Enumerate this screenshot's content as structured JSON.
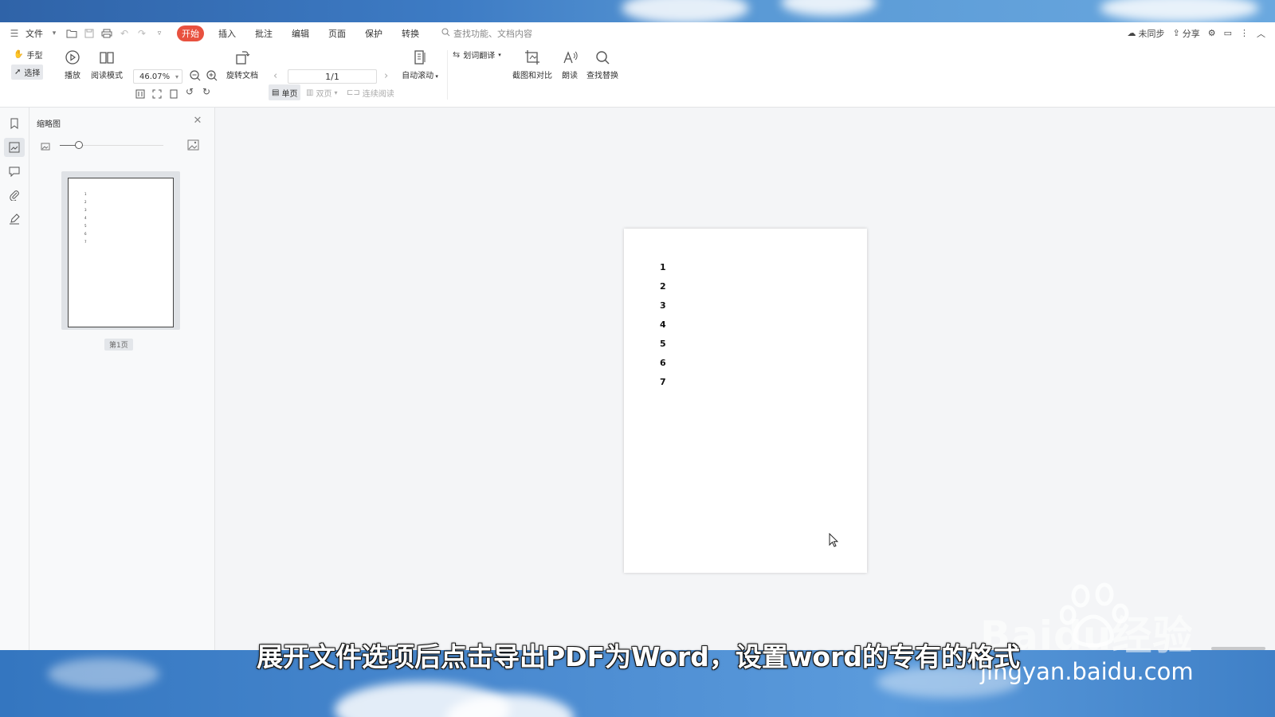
{
  "menu": {
    "file_label": "文件",
    "tabs": [
      "开始",
      "插入",
      "批注",
      "编辑",
      "页面",
      "保护",
      "转换"
    ],
    "active_tab": "开始",
    "search_placeholder": "查找功能、文档内容",
    "sync_label": "未同步",
    "share_label": "分享"
  },
  "toolbar": {
    "hand_label": "手型",
    "select_label": "选择",
    "play_label": "播放",
    "read_mode_label": "阅读模式",
    "zoom_value": "46.07%",
    "rotate_doc_label": "旋转文档",
    "page_indicator": "1/1",
    "single_page_label": "单页",
    "double_page_label": "双页",
    "continuous_label": "连续阅读",
    "auto_scroll_label": "自动滚动",
    "translate_label": "划词翻译",
    "screenshot_compare_label": "截图和对比",
    "read_aloud_label": "朗读",
    "find_replace_label": "查找替换"
  },
  "thumbnail_panel": {
    "title": "缩略图",
    "page_label": "第1页",
    "thumb_lines": [
      "1",
      "2",
      "3",
      "4",
      "5",
      "6",
      "7"
    ]
  },
  "document": {
    "lines": [
      "1",
      "2",
      "3",
      "4",
      "5",
      "6",
      "7"
    ]
  },
  "overlay": {
    "subtitle": "展开文件选项后点击导出PDF为Word，设置word的专有的格式",
    "watermark_brand": "Baidu经验",
    "watermark_url": "jingyan.baidu.com"
  },
  "colors": {
    "active_tab_bg": "#e8513f",
    "sky": "#4a8ad0"
  }
}
